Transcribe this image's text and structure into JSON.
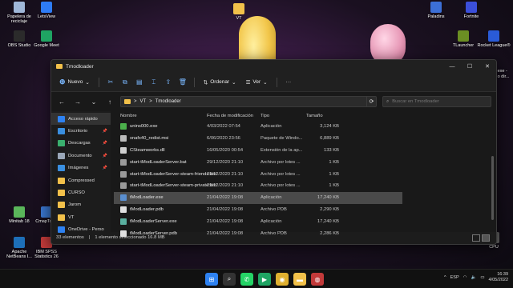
{
  "desktop": {
    "icons_left": [
      {
        "label": "Papelera de reciclaje",
        "color": "#9fb7d8"
      },
      {
        "label": "LetsView",
        "color": "#2e7cf6"
      },
      {
        "label": "OBS Studio",
        "color": "#2b2b2b"
      },
      {
        "label": "Google Meet",
        "color": "#1fa463"
      },
      {
        "label": "Minitab 18",
        "color": "#5ab65a"
      },
      {
        "label": "CmapTools",
        "color": "#3a77d0"
      },
      {
        "label": "Apache NetBeans I...",
        "color": "#1d6fb8"
      },
      {
        "label": "IBM SPSS Statistics 26",
        "color": "#c23a3a"
      }
    ],
    "icons_right": [
      {
        "label": "Paladins",
        "color": "#3c6fd6"
      },
      {
        "label": "Fortnite",
        "color": "#3b4fd9"
      },
      {
        "label": "TLauncher",
        "color": "#6b8e23"
      },
      {
        "label": "Rocket League®",
        "color": "#2a5bd7"
      },
      {
        "label": "CPU",
        "color": "#666666"
      }
    ],
    "icon_top": {
      "label": "VT",
      "color": "#f2c14a"
    },
    "peek_right": [
      "...exe -",
      "...o dir..."
    ]
  },
  "window": {
    "title": "Tmodloader",
    "controls": {
      "minimize": "—",
      "maximize": "☐",
      "close": "✕"
    },
    "toolbar": {
      "new_label": "Nuevo",
      "sort_label": "Ordenar",
      "view_label": "Ver",
      "more": "···"
    },
    "address": {
      "segments": [
        "VT",
        "Tmodloader"
      ],
      "separator": ">"
    },
    "search": {
      "placeholder": "Buscar en Tmodloader"
    },
    "sidebar": [
      {
        "label": "Acceso rápido",
        "icon": "star-icon",
        "color": "#2e82f2",
        "active": true,
        "pinned": false
      },
      {
        "label": "Escritorio",
        "icon": "desktop-icon",
        "color": "#3a8fe0",
        "pinned": true
      },
      {
        "label": "Descargas",
        "icon": "download-icon",
        "color": "#3ab06e",
        "pinned": true
      },
      {
        "label": "Documento",
        "icon": "document-icon",
        "color": "#9aa7b8",
        "pinned": true
      },
      {
        "label": "Imágenes",
        "icon": "image-icon",
        "color": "#3a8fe0",
        "pinned": true
      },
      {
        "label": "Compressed",
        "icon": "folder-icon",
        "color": "#f2c14a",
        "pinned": false
      },
      {
        "label": "CURSO",
        "icon": "folder-icon",
        "color": "#f2c14a",
        "pinned": false
      },
      {
        "label": "Jarom",
        "icon": "folder-icon",
        "color": "#f2c14a",
        "pinned": false
      },
      {
        "label": "VT",
        "icon": "folder-icon",
        "color": "#f2c14a",
        "pinned": false
      },
      {
        "label": "OneDrive - Perso",
        "icon": "cloud-icon",
        "color": "#2e82f2",
        "pinned": false
      }
    ],
    "columns": {
      "name": "Nombre",
      "date": "Fecha de modificación",
      "type": "Tipo",
      "size": "Tamaño"
    },
    "files": [
      {
        "name": "unins000.exe",
        "date": "4/03/2022 07:54",
        "type": "Aplicación",
        "size": "3,124 KB",
        "color": "#4bb04b"
      },
      {
        "name": "xnafx40_redist.msi",
        "date": "6/06/2020 23:56",
        "type": "Paquete de Windo...",
        "size": "6,889 KB",
        "color": "#bcbcbc"
      },
      {
        "name": "CSteamworks.dll",
        "date": "16/05/2020 00:54",
        "type": "Extensión de la ap...",
        "size": "133 KB",
        "color": "#d0d0d0"
      },
      {
        "name": "start-tModLoaderServer.bat",
        "date": "29/12/2020 21:10",
        "type": "Archivo por lotes ...",
        "size": "1 KB",
        "color": "#9a9a9a"
      },
      {
        "name": "start-tModLoaderServer-steam-friends.bat",
        "date": "29/12/2020 21:10",
        "type": "Archivo por lotes ...",
        "size": "1 KB",
        "color": "#9a9a9a"
      },
      {
        "name": "start-tModLoaderServer-steam-private.bat",
        "date": "29/12/2020 21:10",
        "type": "Archivo por lotes ...",
        "size": "1 KB",
        "color": "#9a9a9a"
      },
      {
        "name": "tModLoader.exe",
        "date": "21/04/2022 19:08",
        "type": "Aplicación",
        "size": "17,240 KB",
        "color": "#5a8fd0",
        "selected": true
      },
      {
        "name": "tModLoader.pdb",
        "date": "21/04/2022 19:08",
        "type": "Archivo PDB",
        "size": "2,290 KB",
        "color": "#e0e0e0"
      },
      {
        "name": "tModLoaderServer.exe",
        "date": "21/04/2022 19:08",
        "type": "Aplicación",
        "size": "17,240 KB",
        "color": "#5ab0a0"
      },
      {
        "name": "tModLoaderServer.pdb",
        "date": "21/04/2022 19:08",
        "type": "Archivo PDB",
        "size": "2,286 KB",
        "color": "#e0e0e0"
      }
    ],
    "status": {
      "count": "33 elementos",
      "selection": "1 elemento seleccionado  16.8 MB"
    }
  },
  "taskbar": {
    "apps": [
      {
        "name": "start-icon",
        "color": "#2e82f2",
        "glyph": "⊞"
      },
      {
        "name": "search-icon",
        "color": "#333333",
        "glyph": "⌕"
      },
      {
        "name": "whatsapp-icon",
        "color": "#25d366",
        "glyph": "✆"
      },
      {
        "name": "meet-icon",
        "color": "#1fa463",
        "glyph": "▶"
      },
      {
        "name": "chrome-icon",
        "color": "#e0b030",
        "glyph": "◉"
      },
      {
        "name": "explorer-icon",
        "color": "#f2c14a",
        "glyph": "▬"
      },
      {
        "name": "app-icon",
        "color": "#c23a3a",
        "glyph": "◍"
      }
    ],
    "tray": {
      "chevron": "^",
      "lang": "ESP",
      "time": "16:39",
      "date": "4/05/2022"
    }
  }
}
